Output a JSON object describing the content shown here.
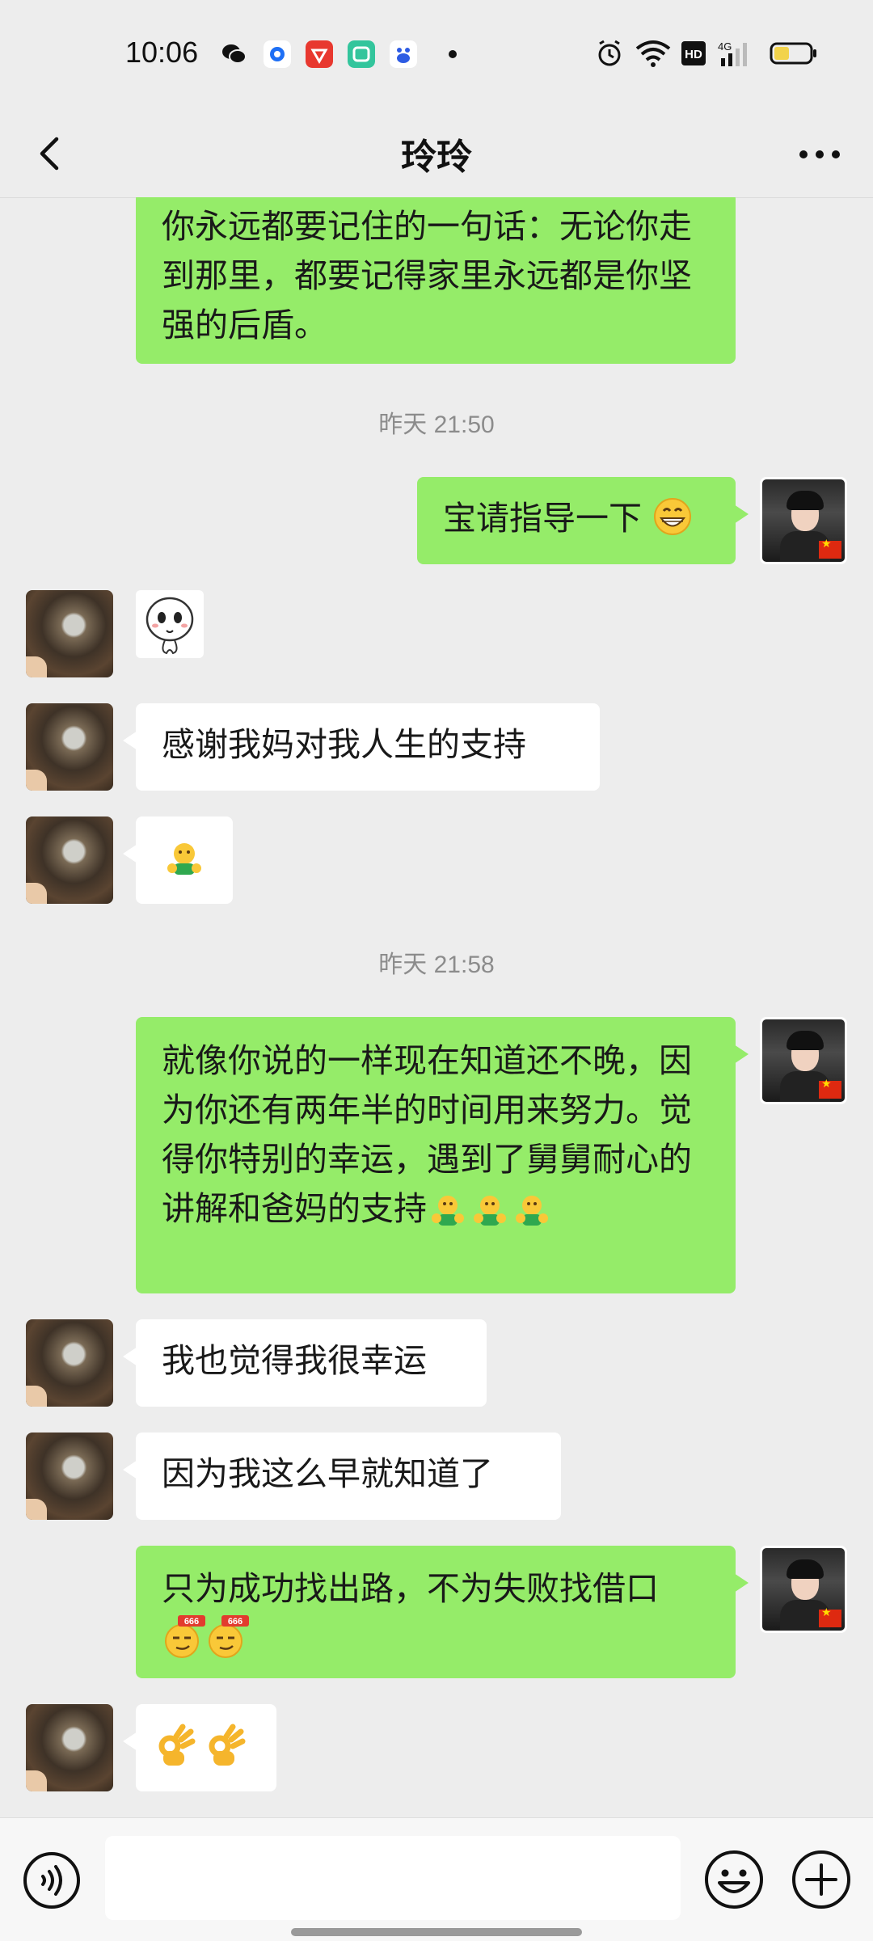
{
  "status_bar": {
    "time": "10:06"
  },
  "nav": {
    "title": "玲玲"
  },
  "messages": {
    "m1": {
      "text": "你永远都要记住的一句话：无论你走到那里，都要记得家里永远都是你坚强的后盾。"
    },
    "ts1": {
      "text": "昨天 21:50"
    },
    "m2": {
      "text": "宝请指导一下"
    },
    "m4": {
      "text": "感谢我妈对我人生的支持"
    },
    "ts2": {
      "text": "昨天 21:58"
    },
    "m6": {
      "text": "就像你说的一样现在知道还不晚，因为你还有两年半的时间用来努力。觉得你特别的幸运，遇到了舅舅耐心的讲解和爸妈的支持"
    },
    "m7": {
      "text": "我也觉得我很幸运"
    },
    "m8": {
      "text": "因为我这么早就知道了"
    },
    "m9": {
      "text": "只为成功找出路，不为失败找借口"
    }
  },
  "icons": {
    "back": "chevron-left-icon",
    "more": "more-dots-icon",
    "voice": "voice-input-icon",
    "emoji": "emoji-face-icon",
    "plus": "plus-circle-icon"
  },
  "colors": {
    "background": "#ededed",
    "my_bubble": "#95ec69",
    "their_bubble": "#ffffff",
    "timestamp": "#8c8c8c"
  }
}
